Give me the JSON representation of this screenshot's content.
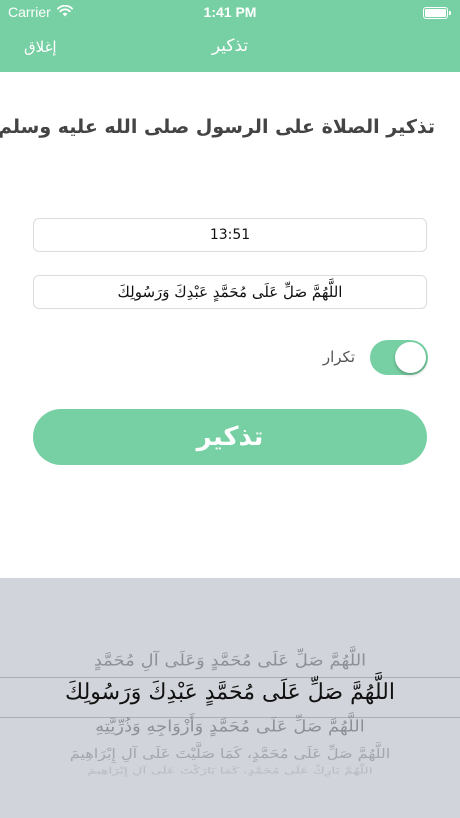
{
  "status_bar": {
    "carrier": "Carrier",
    "time": "1:41 PM",
    "battery_level": 1.0,
    "icons": [
      "wifi-icon",
      "battery-icon"
    ]
  },
  "nav": {
    "title": "تذكير",
    "close_label": "إغلاق"
  },
  "heading": "تذكير الصلاة على الرسول صلى الله عليه وسلم",
  "form": {
    "time_value": "13:51",
    "text_value": "اللَّهُمَّ صَلِّ عَلَى مُحَمَّدٍ عَبْدِكَ وَرَسُولِكَ",
    "repeat_label": "تكرار",
    "repeat_on": true,
    "submit_label": "تذكير"
  },
  "picker": {
    "rows": [
      "اللَّهُمَّ صَلِّ عَلَى مُحَمَّدٍ وَعَلَى آلِ مُحَمَّدٍ",
      "اللَّهُمَّ صَلِّ عَلَى مُحَمَّدٍ عَبْدِكَ وَرَسُولِكَ",
      "اللَّهُمَّ صَلِّ عَلَى مُحَمَّدٍ وَأَزْوَاجِهِ وَذُرِّيَّتِهِ",
      "اللَّهُمَّ صَلِّ عَلَى مُحَمَّدٍ، كَمَا صَلَّيْتَ عَلَى آلِ إِبْرَاهِيمَ",
      "اللَّهُمَّ بَارِكْ عَلَى مُحَمَّدٍ، كَمَا بَارَكْتَ عَلَى آلِ إِبْرَاهِيمَ"
    ],
    "selected_index": 1
  },
  "colors": {
    "accent": "#77d0a3",
    "picker_background": "#d1d4da"
  }
}
